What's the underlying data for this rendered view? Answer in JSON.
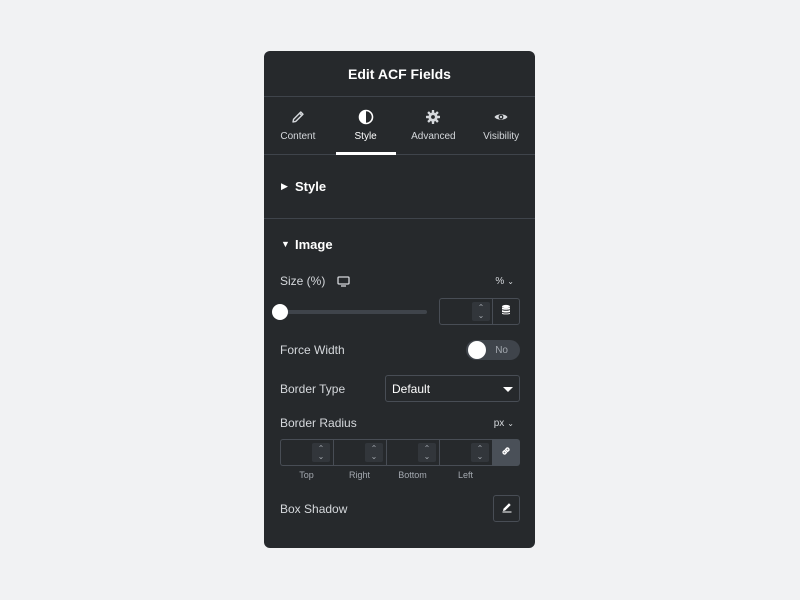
{
  "panel": {
    "title": "Edit ACF Fields",
    "tabs": [
      {
        "label": "Content",
        "icon": "pencil-icon",
        "active": false
      },
      {
        "label": "Style",
        "icon": "half-circle-icon",
        "active": true
      },
      {
        "label": "Advanced",
        "icon": "gear-icon",
        "active": false
      },
      {
        "label": "Visibility",
        "icon": "eye-icon",
        "active": false
      }
    ]
  },
  "sections": {
    "style": {
      "label": "Style",
      "expanded": false
    },
    "image": {
      "label": "Image",
      "expanded": true
    }
  },
  "controls": {
    "size": {
      "label": "Size (%)",
      "unit": "%",
      "device_icon": "desktop-icon",
      "slider_value": 0,
      "value": ""
    },
    "force_width": {
      "label": "Force Width",
      "toggle_text": "No",
      "checked": false
    },
    "border_type": {
      "label": "Border Type",
      "value": "Default"
    },
    "border_radius": {
      "label": "Border Radius",
      "unit": "px",
      "sides": [
        "Top",
        "Right",
        "Bottom",
        "Left"
      ]
    },
    "box_shadow": {
      "label": "Box Shadow"
    }
  },
  "colors": {
    "background": "#f1f2f3",
    "panel": "#26292c",
    "border": "#3f444b",
    "text": "#d5d8dc",
    "accent": "#ffffff"
  }
}
